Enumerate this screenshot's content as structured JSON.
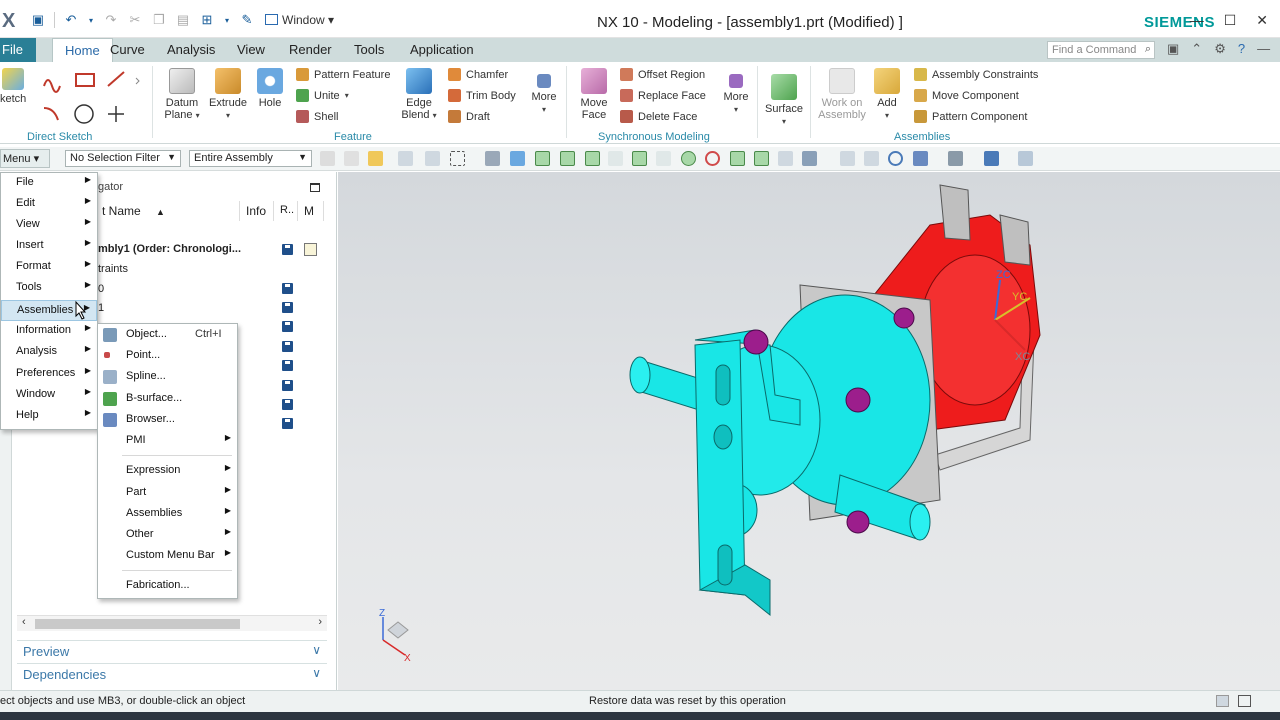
{
  "window": {
    "title": "NX 10 - Modeling - [assembly1.prt (Modified) ]",
    "brand": "SIEMENS",
    "window_menu": "Window"
  },
  "tabs": [
    "File",
    "Home",
    "Curve",
    "Analysis",
    "View",
    "Render",
    "Tools",
    "Application"
  ],
  "active_tab": "Home",
  "find_command_placeholder": "Find a Command",
  "ribbon": {
    "direct_sketch": {
      "sketch_label": "ketch",
      "group_label": "Direct Sketch"
    },
    "feature": {
      "datum_plane": "Datum Plane",
      "extrude": "Extrude",
      "hole": "Hole",
      "pattern_feature": "Pattern Feature",
      "unite": "Unite",
      "shell": "Shell",
      "edge_blend": "Edge Blend",
      "chamfer": "Chamfer",
      "trim_body": "Trim Body",
      "draft": "Draft",
      "more": "More",
      "group_label": "Feature"
    },
    "sync": {
      "move_face": "Move Face",
      "offset_region": "Offset Region",
      "replace_face": "Replace Face",
      "delete_face": "Delete Face",
      "more": "More",
      "group_label": "Synchronous Modeling"
    },
    "surface": "Surface",
    "assemblies": {
      "work_on_assembly": "Work on Assembly",
      "add": "Add",
      "assembly_constraints": "Assembly Constraints",
      "move_component": "Move Component",
      "pattern_component": "Pattern Component",
      "group_label": "Assemblies"
    }
  },
  "selection_bar": {
    "menu_label": "Menu",
    "selection_filter": "No Selection Filter",
    "scope": "Entire Assembly"
  },
  "navigator": {
    "title": "gator",
    "columns": [
      "t Name",
      "Info",
      "R..",
      "M"
    ],
    "rows": [
      "mbly1 (Order: Chronologi...",
      "traints",
      "0",
      "1"
    ]
  },
  "main_menu": {
    "items": [
      "File",
      "Edit",
      "View",
      "Insert",
      "Format",
      "Tools",
      "Assemblies",
      "Information",
      "Analysis",
      "Preferences",
      "Window",
      "Help"
    ],
    "highlighted": "Assemblies"
  },
  "sub_menu": {
    "items": [
      {
        "label": "Object...",
        "shortcut": "Ctrl+I"
      },
      {
        "label": "Point..."
      },
      {
        "label": "Spline..."
      },
      {
        "label": "B-surface..."
      },
      {
        "label": "Browser..."
      },
      {
        "label": "PMI"
      },
      {
        "label": "Expression"
      },
      {
        "label": "Part"
      },
      {
        "label": "Assemblies"
      },
      {
        "label": "Other"
      },
      {
        "label": "Custom Menu Bar"
      },
      {
        "label": "Fabrication..."
      }
    ]
  },
  "panes": [
    "Preview",
    "Dependencies"
  ],
  "triad": {
    "x": "X",
    "z": "Z",
    "xc": "XC",
    "yc": "YC",
    "zc": "ZC"
  },
  "status": {
    "left": "ect objects and use MB3, or double-click an object",
    "center": "Restore data was reset by this operation"
  },
  "colors": {
    "teal": "#2a8aa8",
    "body_cyan": "#19e6e6",
    "body_red": "#ee1c1c",
    "screws": "#9c1e8c",
    "brand": "#009999"
  }
}
